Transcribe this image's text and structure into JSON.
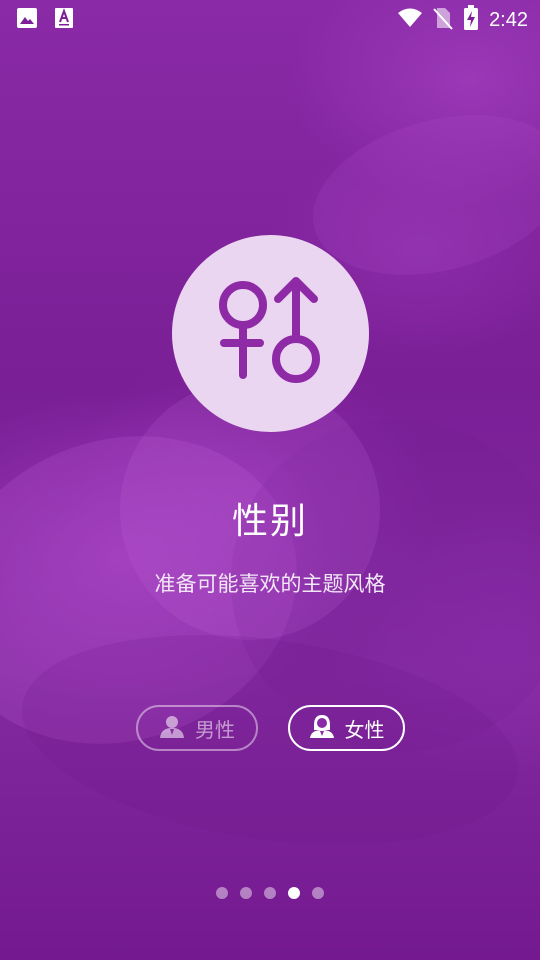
{
  "status_bar": {
    "time": "2:42",
    "left_icons": [
      "image-icon",
      "font-icon"
    ],
    "right_icons": [
      "wifi-icon",
      "no-sim-icon",
      "battery-charging-icon"
    ]
  },
  "page": {
    "title": "性别",
    "subtitle": "准备可能喜欢的主题风格",
    "illustration": "gender-symbols-icon"
  },
  "gender_options": [
    {
      "label": "男性",
      "icon": "male-user-icon",
      "selected": false
    },
    {
      "label": "女性",
      "icon": "female-user-icon",
      "selected": true
    }
  ],
  "pager": {
    "total": 5,
    "active_index": 3
  },
  "colors": {
    "background": "#7d2097",
    "accent": "#8e2aa6",
    "circle": "#ead6f0",
    "text": "#ffffff"
  }
}
